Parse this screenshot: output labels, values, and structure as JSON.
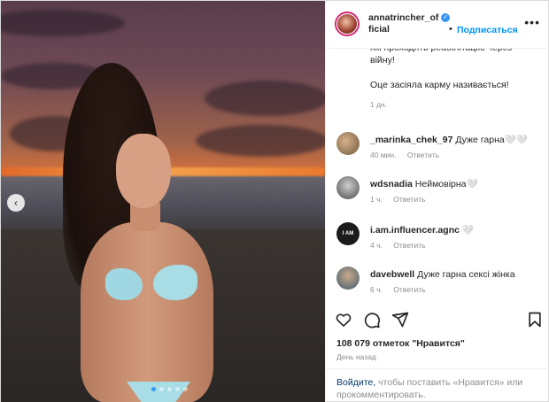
{
  "post": {
    "carousel": {
      "dots": 5,
      "active_dot": 0
    },
    "prev_icon": "chevron-left-icon"
  },
  "header": {
    "username_line1": "annatrincher_of",
    "username_line2": "ficial",
    "verified_icon": "verified-badge-icon",
    "separator": "•",
    "follow_label": "Подписаться",
    "more_icon": "more-horizontal-icon"
  },
  "caption": {
    "line1": "які проходять реабілітацію через війну!",
    "line2": "Оце засіяла карму називається!",
    "time": "1 дн."
  },
  "comments": [
    {
      "user": "_marinka_chek_97",
      "text": "Дуже гарна🤍🤍",
      "time": "40 мин.",
      "reply": "Ответить"
    },
    {
      "user": "wdsnadia",
      "text": "Неймовірна🤍",
      "time": "1 ч.",
      "reply": "Ответить"
    },
    {
      "user": "i.am.influencer.agnc",
      "text": "🤍",
      "time": "4 ч.",
      "reply": "Ответить"
    },
    {
      "user": "davebwell",
      "text": "Дуже гарна сексі жінка",
      "time": "6 ч.",
      "reply": "Ответить"
    }
  ],
  "actions": {
    "like_icon": "heart-outline-icon",
    "comment_icon": "comment-bubble-icon",
    "share_icon": "paper-plane-icon",
    "save_icon": "bookmark-icon"
  },
  "likes": "108 079 отметок \"Нравится\"",
  "date": "День назад",
  "login": {
    "link": "Войдите,",
    "text": " чтобы поставить «Нравится» или прокомментировать."
  },
  "colors": {
    "accent": "#0095f6",
    "text": "#262626",
    "muted": "#8e8e8e",
    "link": "#00376b"
  }
}
